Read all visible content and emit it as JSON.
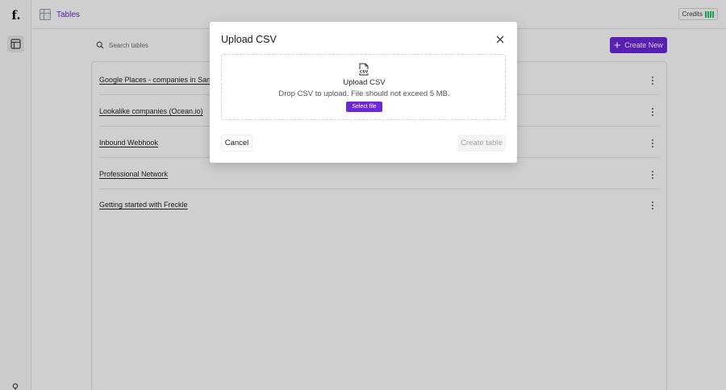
{
  "sidebar": {
    "logo_text": "f.",
    "items": [
      {
        "icon": "table-icon"
      },
      {
        "icon": "user-icon"
      }
    ]
  },
  "header": {
    "breadcrumb_label": "Tables",
    "credits_label": "Credits",
    "credits_bars": 4
  },
  "toolbar": {
    "search_placeholder": "Search tables",
    "create_new_label": "Create New"
  },
  "tables": [
    {
      "name": "Google Places - companies in San"
    },
    {
      "name": "Lookalike companies (Ocean.io)"
    },
    {
      "name": "Inbound Webhook"
    },
    {
      "name": "Professional Network"
    },
    {
      "name": "Getting started with Freckle"
    }
  ],
  "modal": {
    "title": "Upload CSV",
    "dropzone": {
      "icon": "csv-file-icon",
      "title": "Upload CSV",
      "subtitle": "Drop CSV to upload. File should not exceed 5 MB.",
      "select_label": "Select file"
    },
    "cancel_label": "Cancel",
    "create_label": "Create table"
  },
  "colors": {
    "accent": "#6d28d9",
    "overlay": "rgba(0,0,0,0.19)"
  }
}
